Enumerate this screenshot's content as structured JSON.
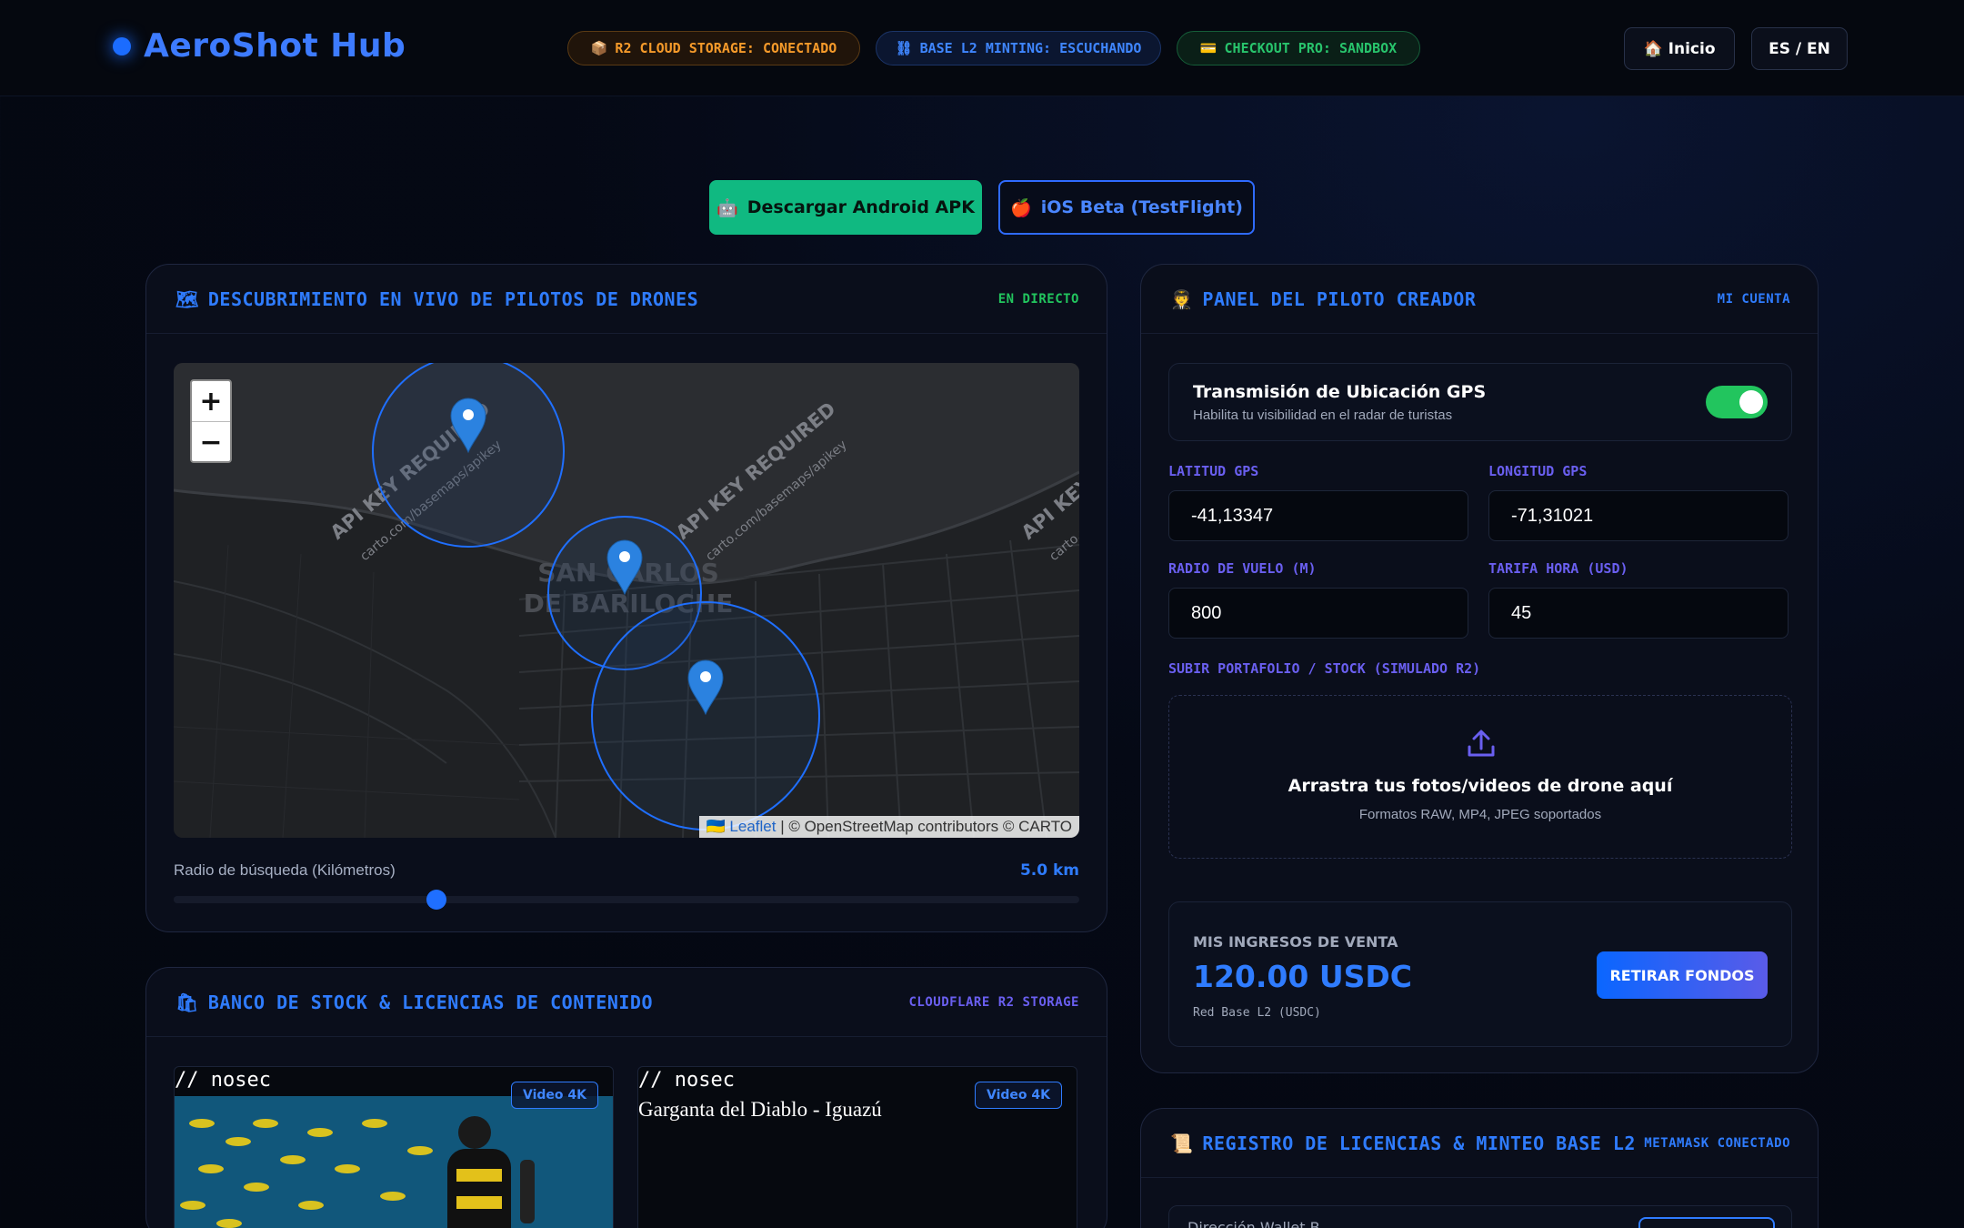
{
  "topbar": {
    "brand": "AeroShot Hub",
    "status_pills": [
      {
        "icon": "📦",
        "label": "R2 CLOUD STORAGE: CONECTADO",
        "color": "#f59a2a"
      },
      {
        "icon": "⛓",
        "label": "BASE L2 MINTING: ESCUCHANDO",
        "color": "#3f86ff"
      },
      {
        "icon": "💳",
        "label": "CHECKOUT PRO: SANDBOX",
        "color": "#28c46c"
      }
    ],
    "home_label": "Inicio",
    "home_icon": "🏠",
    "lang_label": "ES / EN"
  },
  "downloads": {
    "android_icon": "🤖",
    "android_label": "Descargar Android APK",
    "ios_icon": "🍎",
    "ios_label": "iOS Beta (TestFlight)"
  },
  "map_panel": {
    "icon": "🗺",
    "title": "DESCUBRIMIENTO EN VIVO DE PILOTOS DE DRONES",
    "tag": "EN DIRECTO",
    "tag_color": "#22c55e",
    "zoom_in": "+",
    "zoom_out": "−",
    "city_label_1": "SAN CARLOS",
    "city_label_2": "DE BARILOCHE",
    "watermark_main": "API KEY REQUIRED",
    "watermark_sub": "carto.com/basemaps/apikey",
    "attribution_link": "Leaflet",
    "attribution_text": "| © OpenStreetMap contributors © CARTO",
    "slider_label": "Radio de búsqueda (Kilómetros)",
    "slider_value": "5.0 km",
    "slider_fraction": 0.29
  },
  "pilot_panel": {
    "icon": "🧑‍✈️",
    "title": "PANEL DEL PILOTO CREADOR",
    "tag": "MI CUENTA",
    "gps_title": "Transmisión de Ubicación GPS",
    "gps_subtitle": "Habilita tu visibilidad en el radar de turistas",
    "gps_enabled": true,
    "lat_label": "LATITUD GPS",
    "lat_value": "-41,13347",
    "lng_label": "LONGITUD GPS",
    "lng_value": "-71,31021",
    "radius_label": "RADIO DE VUELO (M)",
    "radius_value": "800",
    "rate_label": "TARIFA HORA (USD)",
    "rate_value": "45",
    "upload_label": "SUBIR PORTAFOLIO / STOCK (SIMULADO R2)",
    "upload_title": "Arrastra tus fotos/videos de drone aquí",
    "upload_subtitle": "Formatos RAW, MP4, JPEG soportados",
    "income_label": "MIS INGRESOS DE VENTA",
    "income_value": "120.00 USDC",
    "income_network": "Red Base L2 (USDC)",
    "withdraw_label": "RETIRAR FONDOS"
  },
  "stock_panel": {
    "icon": "🛍",
    "title": "BANCO DE STOCK & LICENCIAS DE CONTENIDO",
    "tag": "CLOUDFLARE R2 STORAGE",
    "items": [
      {
        "code": "// nosec",
        "badge": "Video 4K",
        "alt": ""
      },
      {
        "code": "// nosec",
        "badge": "Video 4K",
        "alt": "Garganta del Diablo - Iguazú"
      }
    ]
  },
  "registry_panel": {
    "icon": "📜",
    "title": "REGISTRO DE LICENCIAS & MINTEO BASE L2",
    "tag": "METAMASK CONECTADO",
    "field_label": "Dirección Wallet B..."
  }
}
